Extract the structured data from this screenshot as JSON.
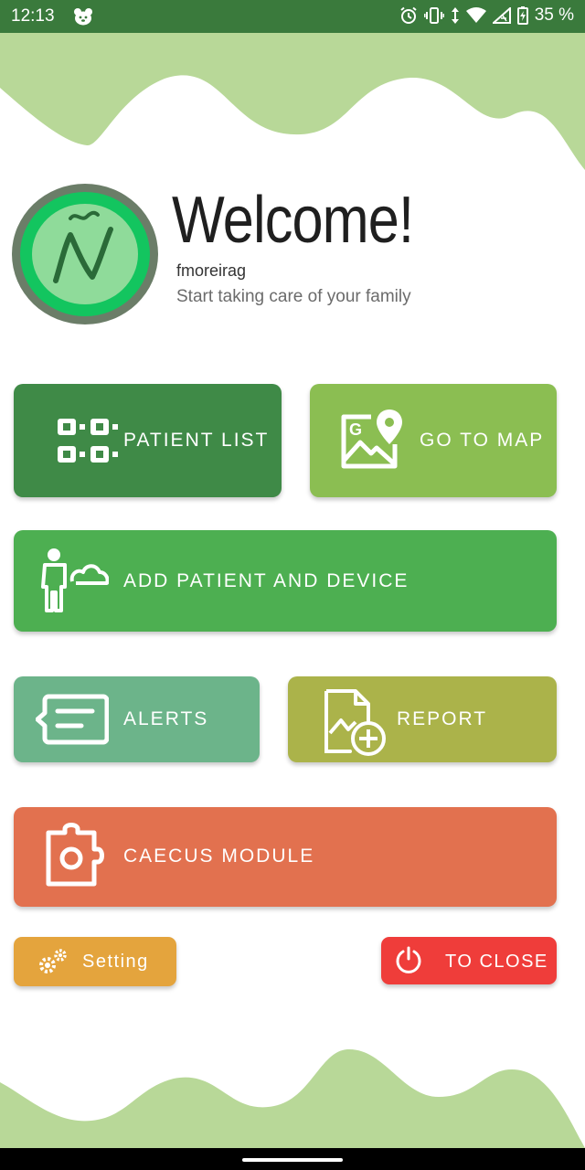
{
  "status_bar": {
    "time": "12:13",
    "battery": "35 %",
    "icons": [
      "bear-icon",
      "alarm-icon",
      "vibrate-icon",
      "data-arrows-icon",
      "wifi-icon",
      "signal-icon",
      "battery-icon"
    ]
  },
  "header": {
    "welcome": "Welcome!",
    "username": "fmoreirag",
    "tagline": "Start taking care of your family",
    "logo_letter": "Ñ"
  },
  "menu": {
    "patient_list": "PATIENT LIST",
    "go_to_map": "GO TO MAP",
    "add_patient": "ADD PATIENT AND DEVICE",
    "alerts": "ALERTS",
    "report": "REPORT",
    "caecus": "CAECUS MODULE",
    "setting": "Setting",
    "close": "TO CLOSE"
  },
  "colors": {
    "status_bar": "#3a7a3c",
    "wave": "#b8d898",
    "patient_list": "#3f8a47",
    "go_to_map": "#8bbe52",
    "add_patient": "#4daf51",
    "alerts": "#6cb48a",
    "report": "#abb34a",
    "caecus": "#e2714f",
    "setting": "#e4a43d",
    "close": "#ef3d3a"
  }
}
